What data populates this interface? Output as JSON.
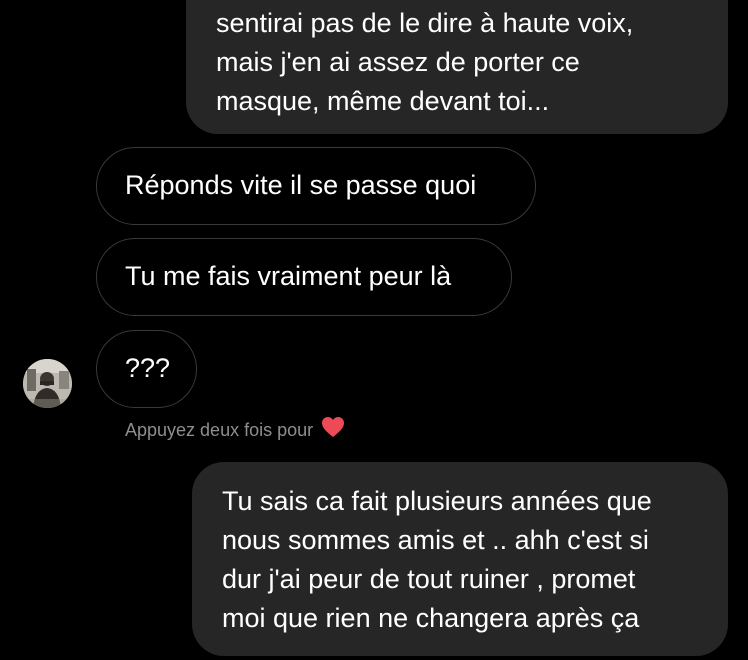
{
  "messages": {
    "outgoing_top": {
      "lines": [
        "sentirai pas de le dire à haute voix,",
        "mais j'en ai assez de porter ce",
        "masque, même devant toi..."
      ]
    },
    "incoming": [
      {
        "text": "Réponds vite il se passe quoi"
      },
      {
        "text": "Tu me fais vraiment peur là"
      },
      {
        "text": "???"
      }
    ],
    "outgoing_bottom": {
      "lines": [
        "Tu sais ca fait plusieurs années que",
        "nous sommes amis et .. ahh c'est si",
        "dur j'ai peur de tout ruiner , promet",
        "moi que rien ne changera après ça"
      ]
    }
  },
  "reaction_hint": {
    "text": "Appuyez deux fois pour",
    "icon": "heart-icon"
  },
  "colors": {
    "background": "#000000",
    "outgoing_bubble": "#262626",
    "incoming_border": "#3a3a3a",
    "hint_text": "#8e8e8e",
    "heart": "#ed4956"
  }
}
